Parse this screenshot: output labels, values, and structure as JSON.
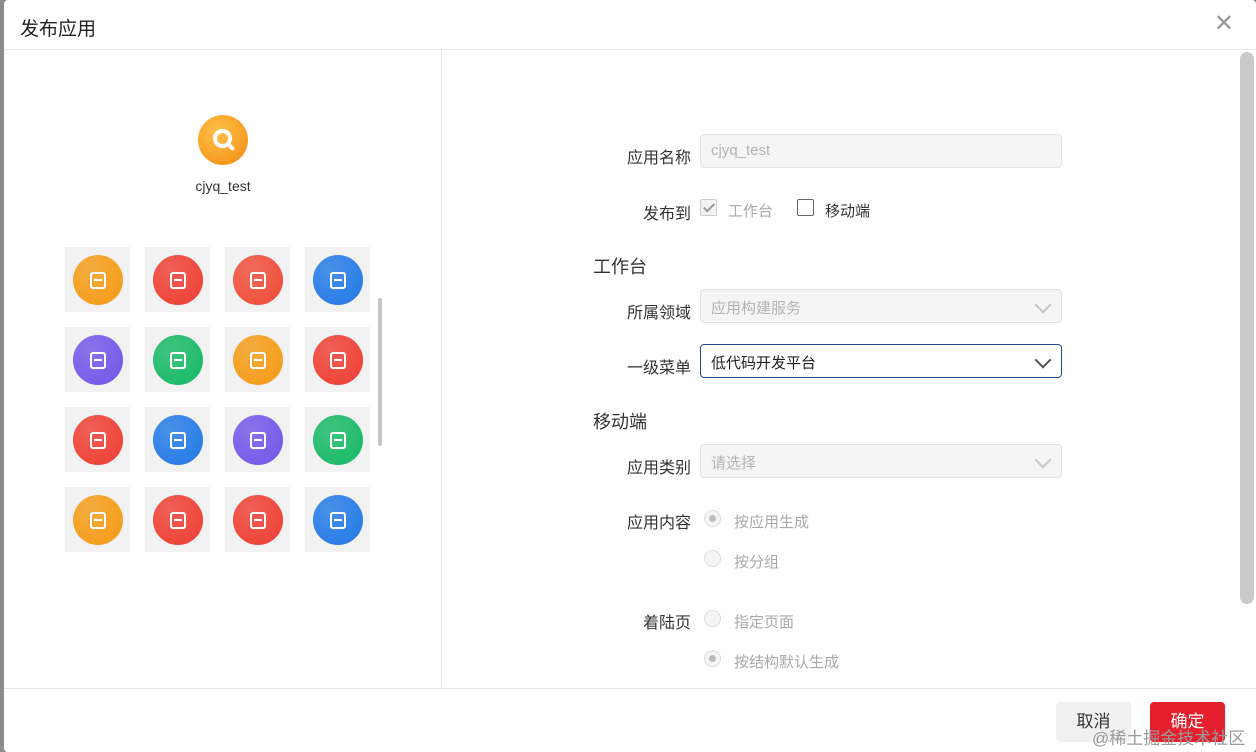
{
  "dialog": {
    "title": "发布应用",
    "close": "✕"
  },
  "app": {
    "name": "cjyq_test"
  },
  "icon_tiles": [
    {
      "color": "#f59a12"
    },
    {
      "color": "#ef3b2f"
    },
    {
      "color": "#ef4a35"
    },
    {
      "color": "#1f78e6"
    },
    {
      "color": "#7253e8"
    },
    {
      "color": "#13b863"
    },
    {
      "color": "#f59a12"
    },
    {
      "color": "#ef3b2f"
    },
    {
      "color": "#ef3b2f"
    },
    {
      "color": "#1f78e6"
    },
    {
      "color": "#7253e8"
    },
    {
      "color": "#13b863"
    },
    {
      "color": "#f59a12"
    },
    {
      "color": "#ef3b2f"
    },
    {
      "color": "#ef3b2f"
    },
    {
      "color": "#1f78e6"
    }
  ],
  "form": {
    "app_name_label": "应用名称",
    "app_name_value": "cjyq_test",
    "publish_to_label": "发布到",
    "workbench_option": "工作台",
    "mobile_option": "移动端",
    "section_workbench": "工作台",
    "domain_label": "所属领域",
    "domain_value": "应用构建服务",
    "menu_label": "一级菜单",
    "menu_value": "低代码开发平台",
    "section_mobile": "移动端",
    "category_label": "应用类别",
    "category_placeholder": "请选择",
    "content_label": "应用内容",
    "content_option_1": "按应用生成",
    "content_option_2": "按分组",
    "landing_label": "着陆页",
    "landing_option_1": "指定页面",
    "landing_option_2": "按结构默认生成"
  },
  "footer": {
    "cancel": "取消",
    "ok": "确定"
  },
  "watermark": "@稀土掘金技术社区"
}
